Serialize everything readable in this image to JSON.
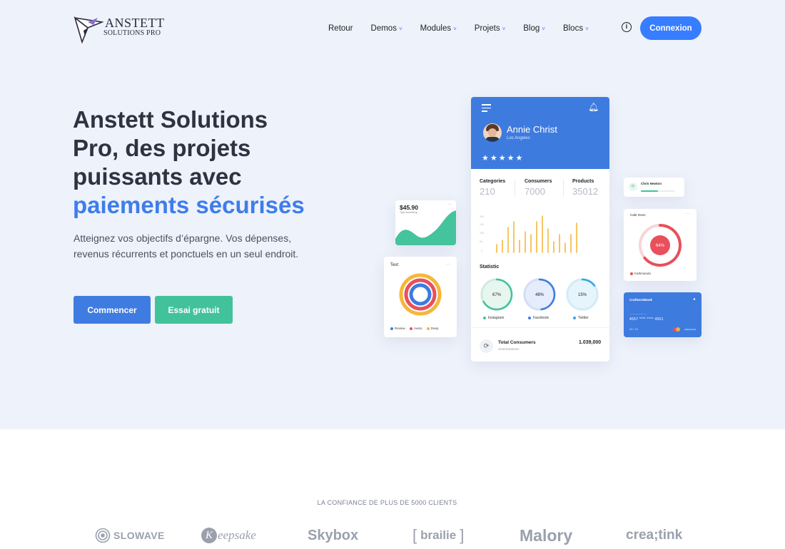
{
  "brand": {
    "name": "ANSTETT",
    "tagline": "SOLUTIONS PRO"
  },
  "nav": {
    "items": [
      {
        "label": "Retour",
        "has_dropdown": false
      },
      {
        "label": "Demos",
        "has_dropdown": true
      },
      {
        "label": "Modules",
        "has_dropdown": true
      },
      {
        "label": "Projets",
        "has_dropdown": true
      },
      {
        "label": "Blog",
        "has_dropdown": true
      },
      {
        "label": "Blocs",
        "has_dropdown": true
      }
    ],
    "info_icon": "info-icon",
    "login_label": "Connexion"
  },
  "hero": {
    "title_line1": "Anstett Solutions",
    "title_line2": "Pro, des projets",
    "title_line3": "puissants avec",
    "title_accent": "paiements sécurisés",
    "description": "Atteignez vos objectifs d’épargne. Vos dépenses, revenus récurrents et ponctuels en un seul endroit.",
    "primary_cta": "Commencer",
    "secondary_cta": "Essai gratuit"
  },
  "mockup": {
    "profile": {
      "name": "Annie Christ",
      "location": "Los Angeles",
      "rating": "★★★★★"
    },
    "stats": [
      {
        "label": "Categories",
        "value": "210"
      },
      {
        "label": "Consumers",
        "value": "7000"
      },
      {
        "label": "Products",
        "value": "35012"
      }
    ],
    "statistic_title": "Statistic",
    "donuts": [
      {
        "value": "67%",
        "label": "Instagram",
        "color": "#42c29b",
        "fraction": 0.67,
        "bg": "#e8f6f0"
      },
      {
        "value": "48%",
        "label": "Facebook",
        "color": "#3e7bdf",
        "fraction": 0.48,
        "bg": "#e5ecfb"
      },
      {
        "value": "15%",
        "label": "Twitter",
        "color": "#2ea6e6",
        "fraction": 0.15,
        "bg": "#e6f4fc"
      }
    ],
    "total": {
      "label": "Total Consumers",
      "sub": "Americanstore",
      "value": "1.039,000"
    },
    "price": {
      "value": "$45.90",
      "sub": "Type something"
    },
    "text_card": {
      "title": "Text",
      "legend": [
        {
          "label": "Review",
          "color": "#3e7bdf"
        },
        {
          "label": "Aveto",
          "color": "#e8505b"
        },
        {
          "label": "Deep",
          "color": "#f5b73b"
        }
      ]
    },
    "chris": {
      "name": "Chris Newton",
      "progress": 0.5
    },
    "cafe": {
      "title": "Cafe Oven",
      "value": "64%",
      "location": "Kathmandu"
    },
    "bank": {
      "name": "CraftworkBank",
      "number": "4557 **** **** 4501",
      "expiry": "04 / 21",
      "brand": "MasterCard"
    }
  },
  "clients": {
    "heading": "LA CONFIANCE DE PLUS DE 5000 CLIENTS",
    "logos": [
      "SLOWAVE",
      "eepsake",
      "Skybox",
      "brailie",
      "Malory",
      "crea;tink"
    ]
  },
  "colors": {
    "primary": "#377dff",
    "accent_text": "#3e7dea",
    "success": "#42c29b",
    "hero_bg": "#eef2fb"
  }
}
